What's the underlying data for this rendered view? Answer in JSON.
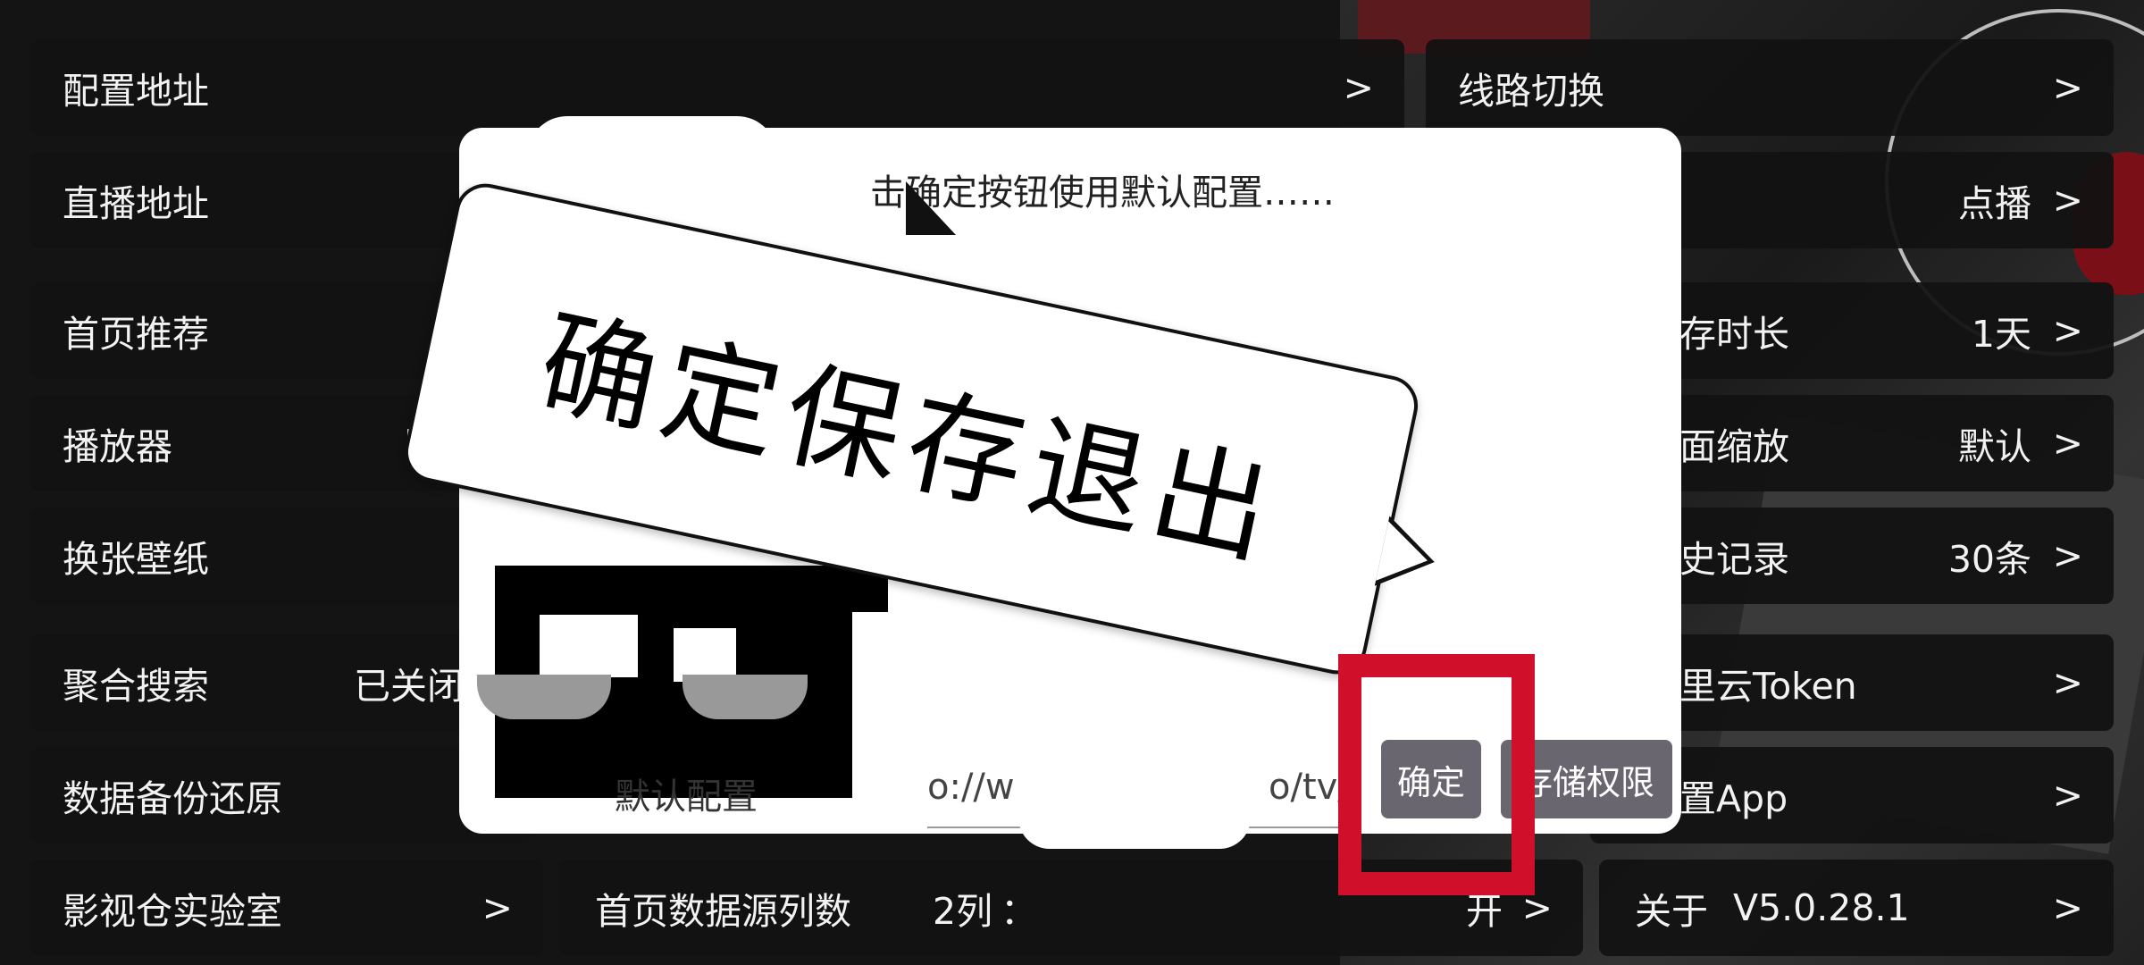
{
  "settings": {
    "config_address": {
      "label": "配置地址",
      "arrow": ">"
    },
    "line_switch": {
      "label": "线路切换",
      "arrow": ">"
    },
    "live_address": {
      "label": "直播地址"
    },
    "home_mode": {
      "value": "点播",
      "arrow": ">"
    },
    "home_recommend": {
      "label": "首页推荐"
    },
    "cache_duration": {
      "label": "存时长",
      "value": "1天",
      "arrow": ">"
    },
    "player": {
      "label": "播放器",
      "value": "E"
    },
    "screen_scale": {
      "label": "面缩放",
      "value": "默认",
      "arrow": ">"
    },
    "wallpaper": {
      "label": "换张壁纸"
    },
    "history": {
      "label": "史记录",
      "value": "30条",
      "arrow": ">"
    },
    "aggregate_search": {
      "label": "聚合搜索",
      "value": "已关闭"
    },
    "aliyun_token": {
      "label": "里云Token",
      "arrow": ">"
    },
    "backup_restore": {
      "label": "数据备份还原"
    },
    "set_app": {
      "label": "置App",
      "arrow": ">"
    },
    "lab": {
      "label": "影视仓实验室",
      "arrow": ">"
    },
    "home_columns": {
      "label": "首页数据源列数",
      "value": "2列",
      "sep": "：",
      "right": "开",
      "arrow": ">"
    },
    "about": {
      "label": "关于",
      "version": "V5.0.28.1",
      "arrow": ">"
    }
  },
  "dialog": {
    "message": "击确定按钮使用默认配置……",
    "default_config_label": "默认配置",
    "url_fragment_1": "o://w",
    "url_fragment_2": "o/tv/",
    "confirm_label": "确定",
    "storage_permission_label": "存储权限"
  },
  "annotation": {
    "bubble_text": "确定保存退出"
  },
  "colors": {
    "background": "#141414",
    "tile": "#121212",
    "dialog": "#ffffff",
    "dialog_button": "#6a6670",
    "highlight": "#d0102a"
  }
}
